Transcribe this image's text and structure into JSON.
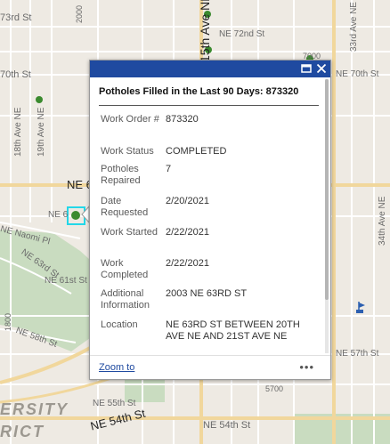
{
  "popup": {
    "title": "Potholes Filled in the Last 90 Days: 873320",
    "fields": [
      {
        "name": "Work Order #",
        "value": "873320"
      },
      {
        "name": "Work Status",
        "value": "COMPLETED"
      },
      {
        "name": "Potholes Repaired",
        "value": "7"
      },
      {
        "name": "Date Requested",
        "value": "2/20/2021"
      },
      {
        "name": "Work Started",
        "value": "2/22/2021"
      },
      {
        "name": "Work Completed",
        "value": "2/22/2021"
      },
      {
        "name": "Additional Information",
        "value": "2003 NE 63RD ST"
      },
      {
        "name": "Location",
        "value": "NE 63RD ST BETWEEN 20TH AVE NE AND 21ST AVE NE"
      }
    ],
    "zoom_label": "Zoom to",
    "more_label": "•••",
    "maximize_icon": "maximize-icon",
    "close_icon": "close-icon",
    "header_color": "#1f4aa0"
  },
  "map": {
    "labels": {
      "ne73": "73rd St",
      "n2000a": "2000",
      "ave15": "15th Ave NE",
      "ne72": "NE 72nd St",
      "n7000": "7000",
      "ave33": "33rd Ave NE",
      "ne70w": "70th St",
      "ne70e": "NE 70th St",
      "ave18": "18th Ave NE",
      "ave19": "19th Ave NE",
      "ne65": "NE 6",
      "ne63": "NE 6",
      "naomi": "NE Naomi Pl",
      "ne63rd": "NE 63rd St",
      "ne61": "NE 61st St",
      "n1800": "1800",
      "ne58": "NE 58th St",
      "ave34": "34th Ave NE",
      "ne57": "NE 57th St",
      "n5700": "5700",
      "ne55": "NE 55th St",
      "ne54w": "NE 54th St",
      "ne54e": "NE 54th St",
      "district_a": "ERSITY",
      "district_b": "RICT"
    },
    "park_color": "#c9dcc0",
    "arterial_color": "#f1d79c",
    "point_color": "#3a8a2e",
    "selection_color": "#23d7e8"
  }
}
